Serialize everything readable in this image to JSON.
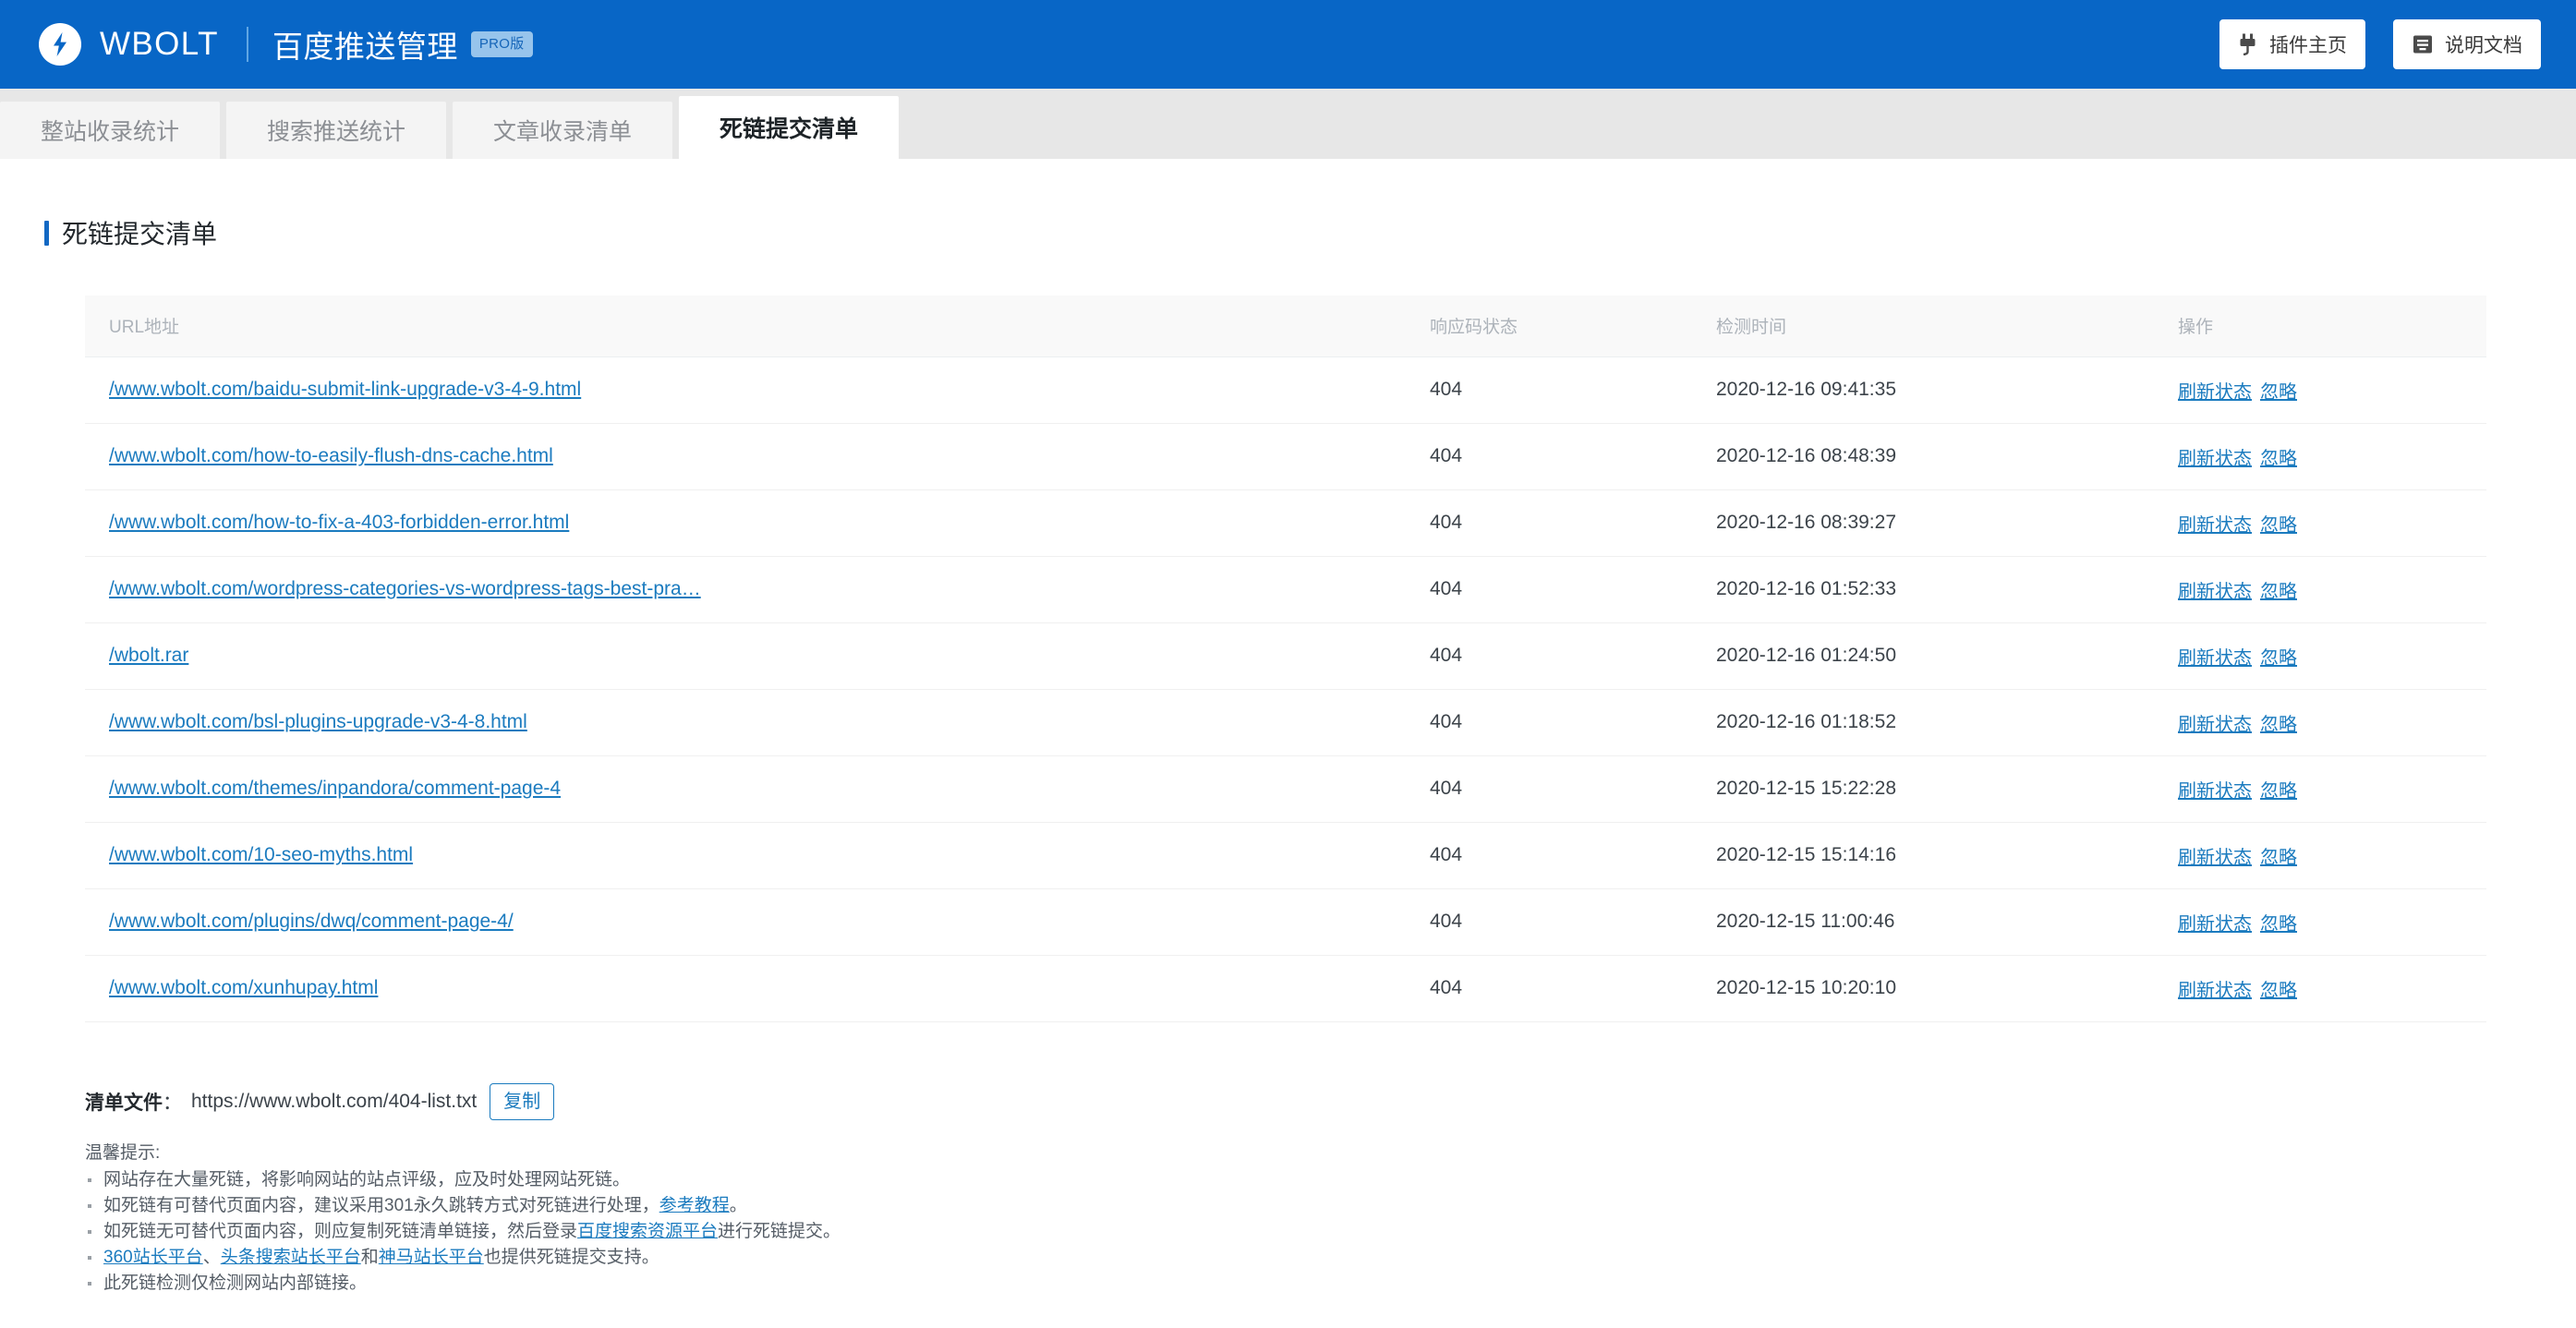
{
  "topbar": {
    "brand_name": "WBOLT",
    "app_title": "百度推送管理",
    "pro_badge": "PRO版",
    "plugin_home_label": "插件主页",
    "docs_label": "说明文档",
    "background_color": "#0866c6"
  },
  "tabs": [
    {
      "label": "整站收录统计",
      "active": false
    },
    {
      "label": "搜索推送统计",
      "active": false
    },
    {
      "label": "文章收录清单",
      "active": false
    },
    {
      "label": "死链提交清单",
      "active": true
    }
  ],
  "section": {
    "title": "死链提交清单",
    "accent_color": "#1268c3"
  },
  "table": {
    "columns": [
      "URL地址",
      "响应码状态",
      "检测时间",
      "操作"
    ],
    "action_refresh": "刷新状态",
    "action_ignore": "忽略",
    "rows": [
      {
        "url": "/www.wbolt.com/baidu-submit-link-upgrade-v3-4-9.html",
        "status": "404",
        "time": "2020-12-16 09:41:35"
      },
      {
        "url": "/www.wbolt.com/how-to-easily-flush-dns-cache.html",
        "status": "404",
        "time": "2020-12-16 08:48:39"
      },
      {
        "url": "/www.wbolt.com/how-to-fix-a-403-forbidden-error.html",
        "status": "404",
        "time": "2020-12-16 08:39:27"
      },
      {
        "url": "/www.wbolt.com/wordpress-categories-vs-wordpress-tags-best-pra…",
        "status": "404",
        "time": "2020-12-16 01:52:33"
      },
      {
        "url": "/wbolt.rar",
        "status": "404",
        "time": "2020-12-16 01:24:50"
      },
      {
        "url": "/www.wbolt.com/bsl-plugins-upgrade-v3-4-8.html",
        "status": "404",
        "time": "2020-12-16 01:18:52"
      },
      {
        "url": "/www.wbolt.com/themes/inpandora/comment-page-4",
        "status": "404",
        "time": "2020-12-15 15:22:28"
      },
      {
        "url": "/www.wbolt.com/10-seo-myths.html",
        "status": "404",
        "time": "2020-12-15 15:14:16"
      },
      {
        "url": "/www.wbolt.com/plugins/dwq/comment-page-4/",
        "status": "404",
        "time": "2020-12-15 11:00:46"
      },
      {
        "url": "/www.wbolt.com/xunhupay.html",
        "status": "404",
        "time": "2020-12-15 10:20:10"
      }
    ]
  },
  "footer": {
    "file_label": "清单文件",
    "file_colon": "：",
    "file_url": "https://www.wbolt.com/404-list.txt",
    "copy_label": "复制",
    "tips_title": "温馨提示:",
    "tips": [
      {
        "parts": [
          {
            "t": "网站存在大量死链，将影响网站的站点评级，应及时处理网站死链。",
            "link": false
          }
        ]
      },
      {
        "parts": [
          {
            "t": "如死链有可替代页面内容，建议采用301永久跳转方式对死链进行处理，",
            "link": false
          },
          {
            "t": "参考教程",
            "link": true
          },
          {
            "t": "。",
            "link": false
          }
        ]
      },
      {
        "parts": [
          {
            "t": "如死链无可替代页面内容，则应复制死链清单链接，然后登录",
            "link": false
          },
          {
            "t": "百度搜索资源平台",
            "link": true
          },
          {
            "t": "进行死链提交。",
            "link": false
          }
        ]
      },
      {
        "parts": [
          {
            "t": "360站长平台",
            "link": true
          },
          {
            "t": "、",
            "link": false
          },
          {
            "t": "头条搜索站长平台",
            "link": true
          },
          {
            "t": "和",
            "link": false
          },
          {
            "t": "神马站长平台",
            "link": true
          },
          {
            "t": "也提供死链提交支持。",
            "link": false
          }
        ]
      },
      {
        "parts": [
          {
            "t": "此死链检测仅检测网站内部链接。",
            "link": false
          }
        ]
      }
    ]
  }
}
